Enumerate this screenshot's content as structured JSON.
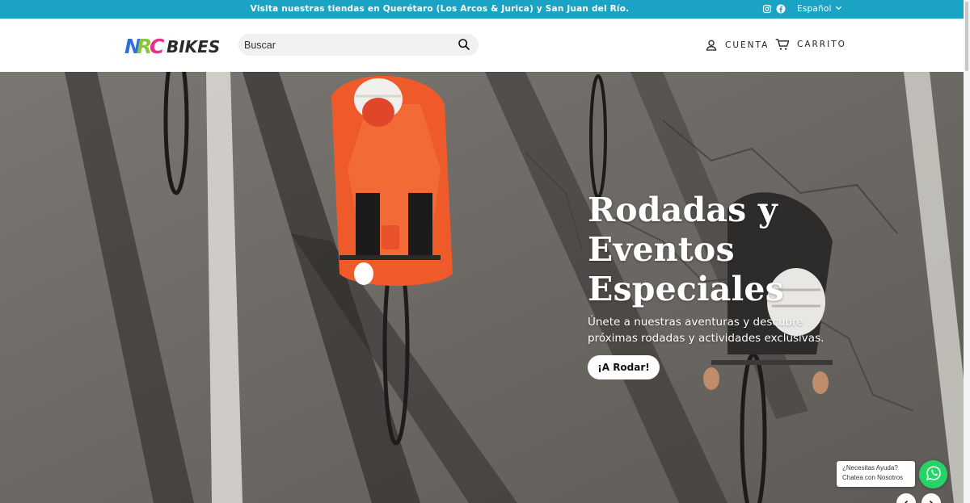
{
  "announcement": {
    "text": "Visita nuestras tiendas en Querétaro (Los Arcos & Jurica) y San Juan del Río.",
    "language": "Español"
  },
  "header": {
    "logo_text": "NRC BIKES",
    "search_placeholder": "Buscar",
    "account_label": "CUENTA",
    "cart_label": "CARRITO"
  },
  "hero": {
    "title_lines": [
      "Rodadas y",
      "Eventos",
      "Especiales"
    ],
    "subtitle": "Únete a nuestras aventuras y descubre próximas rodadas y actividades exclusivas.",
    "button_label": "¡A Rodar!"
  },
  "whatsapp": {
    "line1": "¿Necesitas Ayuda?",
    "line2": "Chatea con Nosotros"
  },
  "colors": {
    "announcement_bg": "#1aa3c4",
    "whatsapp_green": "#25d366"
  },
  "icons": [
    "instagram-icon",
    "facebook-icon",
    "chevron-down-icon",
    "search-icon",
    "user-icon",
    "cart-icon",
    "whatsapp-icon",
    "chevron-left-icon",
    "chevron-right-icon"
  ]
}
